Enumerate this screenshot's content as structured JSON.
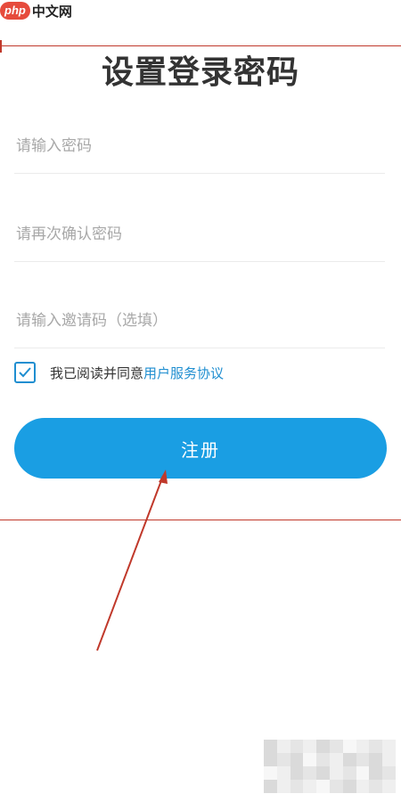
{
  "watermark": {
    "logo": "php",
    "site": "中文网"
  },
  "page": {
    "title": "设置登录密码"
  },
  "form": {
    "password_placeholder": "请输入密码",
    "confirm_placeholder": "请再次确认密码",
    "invite_placeholder": "请输入邀请码（选填）"
  },
  "agreement": {
    "checked": true,
    "text": "我已阅读并同意",
    "link": "用户服务协议"
  },
  "register": {
    "label": "注册"
  },
  "colors": {
    "accent": "#1a9ee3",
    "link": "#1f8ed0",
    "annotation": "#c0392b"
  }
}
